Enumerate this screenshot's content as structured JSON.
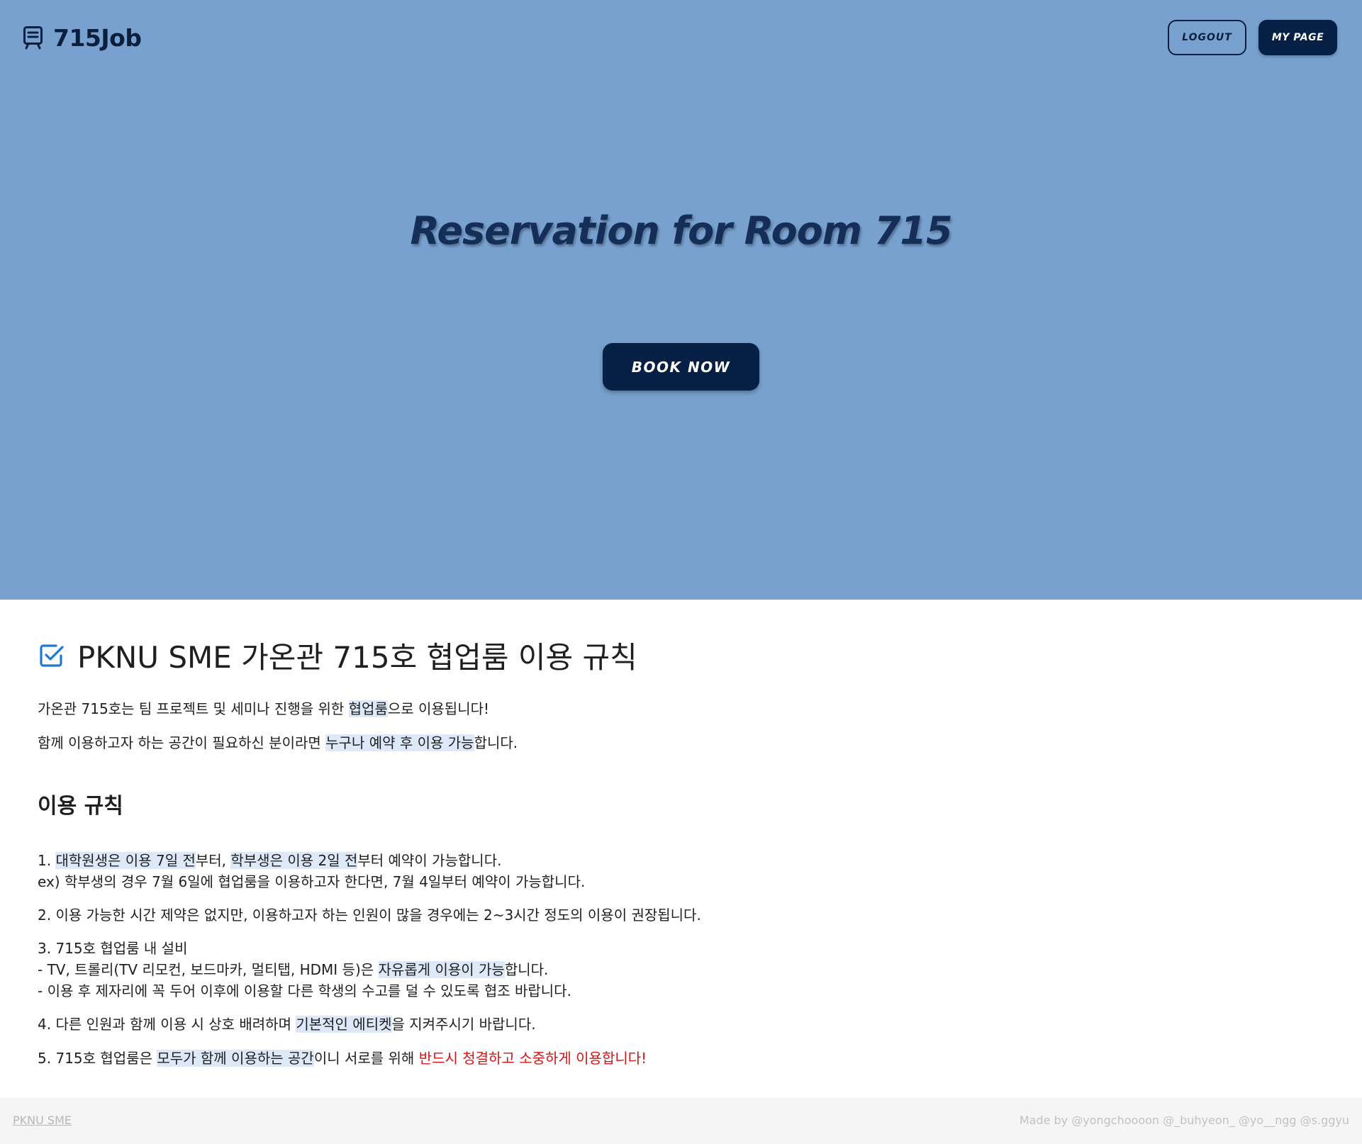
{
  "header": {
    "logo_text": "715Job",
    "logout_label": "LOGOUT",
    "mypage_label": "MY PAGE"
  },
  "hero": {
    "title": "Reservation for Room 715",
    "book_label": "BOOK NOW"
  },
  "rules": {
    "heading": "PKNU SME 가온관 715호 협업룸 이용 규칙",
    "intro1": {
      "a": "가온관 715호는 팀 프로젝트 및 세미나 진행을 위한 ",
      "hl": "협업룸",
      "b": "으로 이용됩니다!"
    },
    "intro2": {
      "a": "함께 이용하고자 하는 공간이 필요하신 분이라면 ",
      "hl": "누구나 예약 후 이용 가능",
      "b": "합니다."
    },
    "subheading": "이용 규칙",
    "r1": {
      "a": "1. ",
      "hl1": "대학원생은 이용 7일 전",
      "b": "부터, ",
      "hl2": "학부생은 이용 2일 전",
      "c": "부터 예약이 가능합니다.",
      "ex": "ex) 학부생의 경우 7월 6일에 협업룸을 이용하고자 한다면, 7월 4일부터 예약이 가능합니다."
    },
    "r2": "2. 이용 가능한 시간 제약은 없지만, 이용하고자 하는 인원이 많을 경우에는 2~3시간 정도의 이용이 권장됩니다.",
    "r3": {
      "title": "3. 715호 협업룸 내 설비",
      "l1a": "- TV, 트롤리(TV 리모컨, 보드마카, 멀티탭, HDMI 등)은 ",
      "l1hl": "자유롭게 이용이 가능",
      "l1b": "합니다.",
      "l2": "- 이용 후 제자리에 꼭 두어 이후에 이용할 다른 학생의 수고를 덜 수 있도록 협조 바랍니다."
    },
    "r4": {
      "a": "4. 다른 인원과 함께 이용 시 상호 배려하며 ",
      "hl": "기본적인 에티켓",
      "b": "을 지켜주시기 바랍니다."
    },
    "r5": {
      "a": "5. 715호 협업룸은 ",
      "hl": "모두가 함께 이용하는 공간",
      "b": "이니 서로를 위해 ",
      "red": "반드시 청결하고 소중하게 이용합니다!"
    }
  },
  "footer": {
    "link": "PKNU SME",
    "credit": "Made by @yongchoooon @_buhyeon_ @yo__ngg @s.ggyu"
  },
  "colors": {
    "hero_bg": "#78a1cf",
    "navy": "#061f44",
    "highlight": "#dde9f8",
    "accent_red": "#d21414",
    "check_blue": "#1e78d4"
  },
  "icons": {
    "logo": "train-icon",
    "rules_heading": "checkbox-checked-icon"
  }
}
